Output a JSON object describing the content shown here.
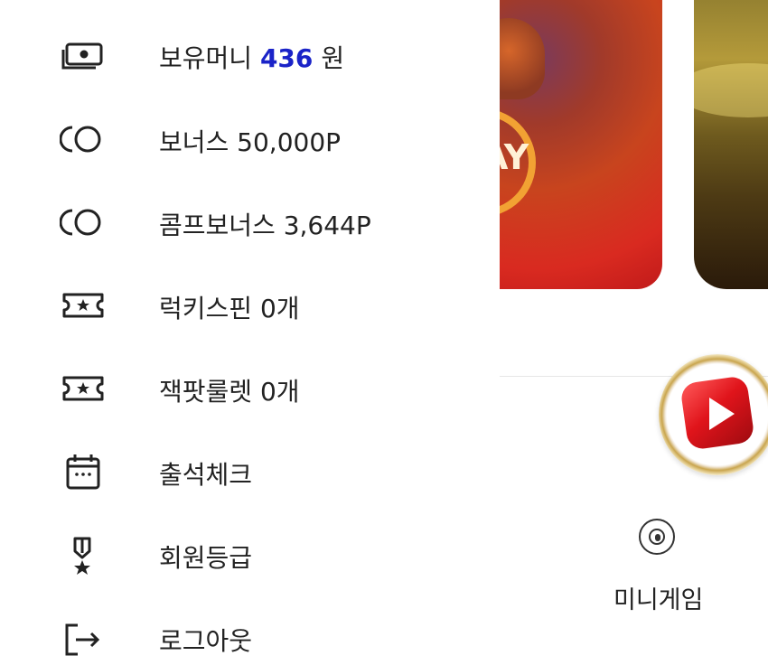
{
  "menu": {
    "items": [
      {
        "icon": "money-icon",
        "label_prefix": "보유머니",
        "amount": "436",
        "label_suffix": "원"
      },
      {
        "icon": "coins-icon",
        "label": "보너스 50,000P"
      },
      {
        "icon": "coins-icon",
        "label": "콤프보너스 3,644P"
      },
      {
        "icon": "ticket-star-icon",
        "label": "럭키스핀 0개"
      },
      {
        "icon": "ticket-star-icon",
        "label": "잭팟룰렛 0개"
      },
      {
        "icon": "calendar-icon",
        "label": "출석체크"
      },
      {
        "icon": "medal-icon",
        "label": "회원등급"
      },
      {
        "icon": "logout-icon",
        "label": "로그아웃"
      }
    ]
  },
  "background": {
    "banner1_text": "AY",
    "mini_game_label": "미니게임",
    "accent_color": "#1a23c8"
  }
}
